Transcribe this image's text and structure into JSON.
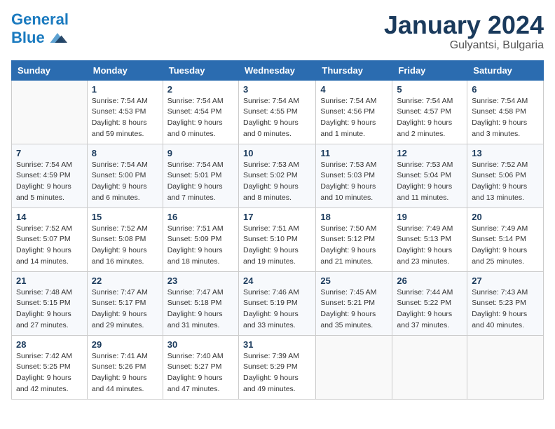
{
  "logo": {
    "line1": "General",
    "line2": "Blue"
  },
  "header": {
    "month": "January 2024",
    "location": "Gulyantsi, Bulgaria"
  },
  "weekdays": [
    "Sunday",
    "Monday",
    "Tuesday",
    "Wednesday",
    "Thursday",
    "Friday",
    "Saturday"
  ],
  "weeks": [
    [
      {
        "day": "",
        "sunrise": "",
        "sunset": "",
        "daylight": ""
      },
      {
        "day": "1",
        "sunrise": "Sunrise: 7:54 AM",
        "sunset": "Sunset: 4:53 PM",
        "daylight": "Daylight: 8 hours and 59 minutes."
      },
      {
        "day": "2",
        "sunrise": "Sunrise: 7:54 AM",
        "sunset": "Sunset: 4:54 PM",
        "daylight": "Daylight: 9 hours and 0 minutes."
      },
      {
        "day": "3",
        "sunrise": "Sunrise: 7:54 AM",
        "sunset": "Sunset: 4:55 PM",
        "daylight": "Daylight: 9 hours and 0 minutes."
      },
      {
        "day": "4",
        "sunrise": "Sunrise: 7:54 AM",
        "sunset": "Sunset: 4:56 PM",
        "daylight": "Daylight: 9 hours and 1 minute."
      },
      {
        "day": "5",
        "sunrise": "Sunrise: 7:54 AM",
        "sunset": "Sunset: 4:57 PM",
        "daylight": "Daylight: 9 hours and 2 minutes."
      },
      {
        "day": "6",
        "sunrise": "Sunrise: 7:54 AM",
        "sunset": "Sunset: 4:58 PM",
        "daylight": "Daylight: 9 hours and 3 minutes."
      }
    ],
    [
      {
        "day": "7",
        "sunrise": "Sunrise: 7:54 AM",
        "sunset": "Sunset: 4:59 PM",
        "daylight": "Daylight: 9 hours and 5 minutes."
      },
      {
        "day": "8",
        "sunrise": "Sunrise: 7:54 AM",
        "sunset": "Sunset: 5:00 PM",
        "daylight": "Daylight: 9 hours and 6 minutes."
      },
      {
        "day": "9",
        "sunrise": "Sunrise: 7:54 AM",
        "sunset": "Sunset: 5:01 PM",
        "daylight": "Daylight: 9 hours and 7 minutes."
      },
      {
        "day": "10",
        "sunrise": "Sunrise: 7:53 AM",
        "sunset": "Sunset: 5:02 PM",
        "daylight": "Daylight: 9 hours and 8 minutes."
      },
      {
        "day": "11",
        "sunrise": "Sunrise: 7:53 AM",
        "sunset": "Sunset: 5:03 PM",
        "daylight": "Daylight: 9 hours and 10 minutes."
      },
      {
        "day": "12",
        "sunrise": "Sunrise: 7:53 AM",
        "sunset": "Sunset: 5:04 PM",
        "daylight": "Daylight: 9 hours and 11 minutes."
      },
      {
        "day": "13",
        "sunrise": "Sunrise: 7:52 AM",
        "sunset": "Sunset: 5:06 PM",
        "daylight": "Daylight: 9 hours and 13 minutes."
      }
    ],
    [
      {
        "day": "14",
        "sunrise": "Sunrise: 7:52 AM",
        "sunset": "Sunset: 5:07 PM",
        "daylight": "Daylight: 9 hours and 14 minutes."
      },
      {
        "day": "15",
        "sunrise": "Sunrise: 7:52 AM",
        "sunset": "Sunset: 5:08 PM",
        "daylight": "Daylight: 9 hours and 16 minutes."
      },
      {
        "day": "16",
        "sunrise": "Sunrise: 7:51 AM",
        "sunset": "Sunset: 5:09 PM",
        "daylight": "Daylight: 9 hours and 18 minutes."
      },
      {
        "day": "17",
        "sunrise": "Sunrise: 7:51 AM",
        "sunset": "Sunset: 5:10 PM",
        "daylight": "Daylight: 9 hours and 19 minutes."
      },
      {
        "day": "18",
        "sunrise": "Sunrise: 7:50 AM",
        "sunset": "Sunset: 5:12 PM",
        "daylight": "Daylight: 9 hours and 21 minutes."
      },
      {
        "day": "19",
        "sunrise": "Sunrise: 7:49 AM",
        "sunset": "Sunset: 5:13 PM",
        "daylight": "Daylight: 9 hours and 23 minutes."
      },
      {
        "day": "20",
        "sunrise": "Sunrise: 7:49 AM",
        "sunset": "Sunset: 5:14 PM",
        "daylight": "Daylight: 9 hours and 25 minutes."
      }
    ],
    [
      {
        "day": "21",
        "sunrise": "Sunrise: 7:48 AM",
        "sunset": "Sunset: 5:15 PM",
        "daylight": "Daylight: 9 hours and 27 minutes."
      },
      {
        "day": "22",
        "sunrise": "Sunrise: 7:47 AM",
        "sunset": "Sunset: 5:17 PM",
        "daylight": "Daylight: 9 hours and 29 minutes."
      },
      {
        "day": "23",
        "sunrise": "Sunrise: 7:47 AM",
        "sunset": "Sunset: 5:18 PM",
        "daylight": "Daylight: 9 hours and 31 minutes."
      },
      {
        "day": "24",
        "sunrise": "Sunrise: 7:46 AM",
        "sunset": "Sunset: 5:19 PM",
        "daylight": "Daylight: 9 hours and 33 minutes."
      },
      {
        "day": "25",
        "sunrise": "Sunrise: 7:45 AM",
        "sunset": "Sunset: 5:21 PM",
        "daylight": "Daylight: 9 hours and 35 minutes."
      },
      {
        "day": "26",
        "sunrise": "Sunrise: 7:44 AM",
        "sunset": "Sunset: 5:22 PM",
        "daylight": "Daylight: 9 hours and 37 minutes."
      },
      {
        "day": "27",
        "sunrise": "Sunrise: 7:43 AM",
        "sunset": "Sunset: 5:23 PM",
        "daylight": "Daylight: 9 hours and 40 minutes."
      }
    ],
    [
      {
        "day": "28",
        "sunrise": "Sunrise: 7:42 AM",
        "sunset": "Sunset: 5:25 PM",
        "daylight": "Daylight: 9 hours and 42 minutes."
      },
      {
        "day": "29",
        "sunrise": "Sunrise: 7:41 AM",
        "sunset": "Sunset: 5:26 PM",
        "daylight": "Daylight: 9 hours and 44 minutes."
      },
      {
        "day": "30",
        "sunrise": "Sunrise: 7:40 AM",
        "sunset": "Sunset: 5:27 PM",
        "daylight": "Daylight: 9 hours and 47 minutes."
      },
      {
        "day": "31",
        "sunrise": "Sunrise: 7:39 AM",
        "sunset": "Sunset: 5:29 PM",
        "daylight": "Daylight: 9 hours and 49 minutes."
      },
      {
        "day": "",
        "sunrise": "",
        "sunset": "",
        "daylight": ""
      },
      {
        "day": "",
        "sunrise": "",
        "sunset": "",
        "daylight": ""
      },
      {
        "day": "",
        "sunrise": "",
        "sunset": "",
        "daylight": ""
      }
    ]
  ]
}
